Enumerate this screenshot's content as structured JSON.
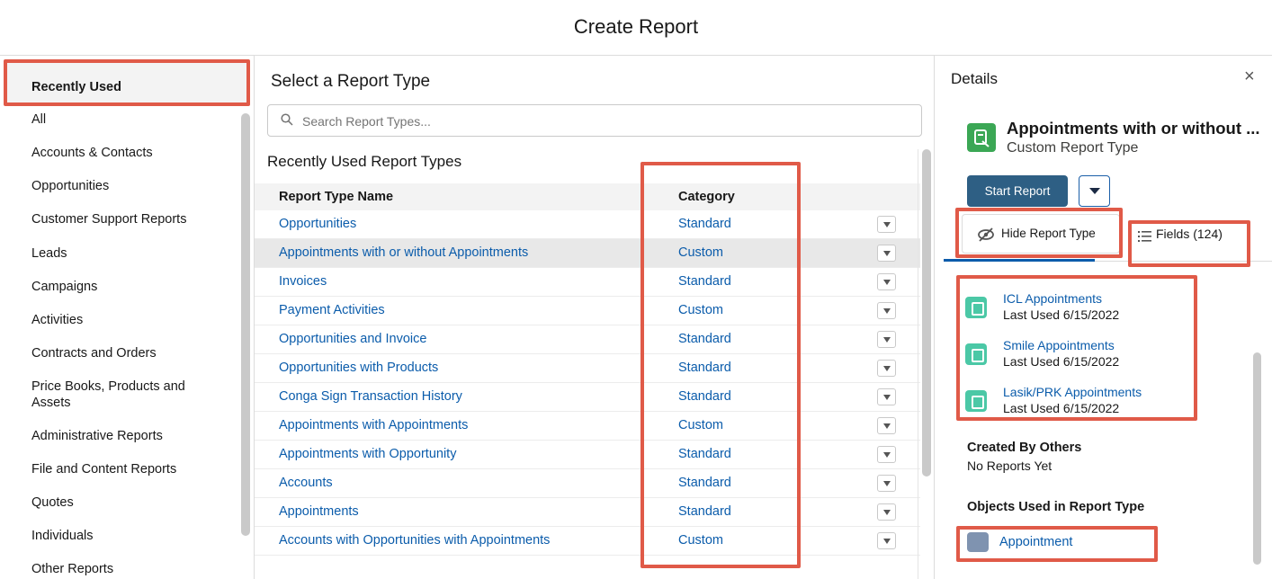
{
  "header": {
    "title": "Create Report"
  },
  "sidebar": {
    "items": [
      {
        "label": "Recently Used"
      },
      {
        "label": "All"
      },
      {
        "label": "Accounts & Contacts"
      },
      {
        "label": "Opportunities"
      },
      {
        "label": "Customer Support Reports"
      },
      {
        "label": "Leads"
      },
      {
        "label": "Campaigns"
      },
      {
        "label": "Activities"
      },
      {
        "label": "Contracts and Orders"
      },
      {
        "label": "Price Books, Products and Assets"
      },
      {
        "label": "Administrative Reports"
      },
      {
        "label": "File and Content Reports"
      },
      {
        "label": "Quotes"
      },
      {
        "label": "Individuals"
      },
      {
        "label": "Other Reports"
      }
    ]
  },
  "main": {
    "heading": "Select a Report Type",
    "search_placeholder": "Search Report Types...",
    "subheading": "Recently Used Report Types",
    "columns": [
      "Report Type Name",
      "Category"
    ],
    "rows": [
      {
        "name": "Opportunities",
        "category": "Standard"
      },
      {
        "name": "Appointments with or without Appointments",
        "category": "Custom"
      },
      {
        "name": "Invoices",
        "category": "Standard"
      },
      {
        "name": "Payment Activities",
        "category": "Custom"
      },
      {
        "name": "Opportunities and Invoice",
        "category": "Standard"
      },
      {
        "name": "Opportunities with Products",
        "category": "Standard"
      },
      {
        "name": "Conga Sign Transaction History",
        "category": "Standard"
      },
      {
        "name": "Appointments with Appointments",
        "category": "Custom"
      },
      {
        "name": "Appointments with Opportunity",
        "category": "Standard"
      },
      {
        "name": "Accounts",
        "category": "Standard"
      },
      {
        "name": "Appointments",
        "category": "Standard"
      },
      {
        "name": "Accounts with Opportunities with Appointments",
        "category": "Custom"
      }
    ]
  },
  "details": {
    "title": "Details",
    "close": "×",
    "report_name": "Appointments with or without ...",
    "report_type": "Custom Report Type",
    "start_button": "Start Report",
    "tab_hide": "Hide Report Type",
    "tab_fields": "Fields (124)",
    "recent": [
      {
        "name": "ICL Appointments",
        "sub": "Last Used 6/15/2022"
      },
      {
        "name": "Smile Appointments",
        "sub": "Last Used 6/15/2022"
      },
      {
        "name": "Lasik/PRK Appointments",
        "sub": "Last Used 6/15/2022"
      }
    ],
    "created_by_others_heading": "Created By Others",
    "created_by_others_text": "No Reports Yet",
    "objects_heading": "Objects Used in Report Type",
    "object_name": "Appointment"
  },
  "colors": {
    "link": "#0b5cab",
    "brand_button": "#2e5f84",
    "annotation": "#e05a48",
    "report_icon": "#3ba755",
    "recent_icon": "#4bc8a6"
  }
}
